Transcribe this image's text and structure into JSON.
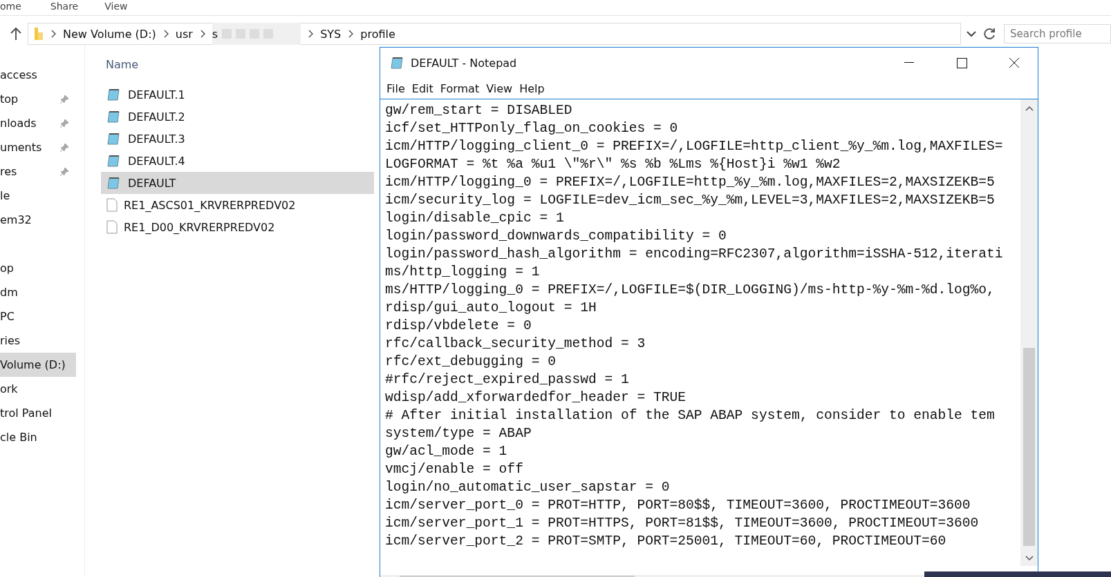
{
  "ribbon_tabs": [
    "ome",
    "Share",
    "View"
  ],
  "address_bar": {
    "crumbs": [
      {
        "kind": "text",
        "label": "New Volume (D:)"
      },
      {
        "kind": "text",
        "label": "usr"
      },
      {
        "kind": "redacted",
        "label": "s"
      },
      {
        "kind": "text",
        "label": "SYS"
      },
      {
        "kind": "text",
        "label": "profile"
      }
    ]
  },
  "search": {
    "placeholder": "Search profile"
  },
  "sidebar": {
    "sections": [
      {
        "items": [
          {
            "label": "access",
            "pinned": false,
            "selected": false
          },
          {
            "label": "top",
            "pinned": true,
            "selected": false
          },
          {
            "label": "nloads",
            "pinned": true,
            "selected": false
          },
          {
            "label": "uments",
            "pinned": true,
            "selected": false
          },
          {
            "label": "res",
            "pinned": true,
            "selected": false
          },
          {
            "label": "le",
            "pinned": false,
            "selected": false
          },
          {
            "label": "em32",
            "pinned": false,
            "selected": false
          }
        ]
      },
      {
        "items": [
          {
            "label": "op",
            "pinned": false,
            "selected": false
          },
          {
            "label": "dm",
            "pinned": false,
            "selected": false
          },
          {
            "label": "PC",
            "pinned": false,
            "selected": false
          },
          {
            "label": "ries",
            "pinned": false,
            "selected": false
          },
          {
            "label": "Volume (D:)",
            "pinned": false,
            "selected": true
          },
          {
            "label": "ork",
            "pinned": false,
            "selected": false
          },
          {
            "label": "trol Panel",
            "pinned": false,
            "selected": false
          },
          {
            "label": "cle Bin",
            "pinned": false,
            "selected": false
          }
        ]
      }
    ]
  },
  "file_list": {
    "column": "Name",
    "files": [
      {
        "name": "DEFAULT.1",
        "kind": "notepad",
        "selected": false
      },
      {
        "name": "DEFAULT.2",
        "kind": "notepad",
        "selected": false
      },
      {
        "name": "DEFAULT.3",
        "kind": "notepad",
        "selected": false
      },
      {
        "name": "DEFAULT.4",
        "kind": "notepad",
        "selected": false
      },
      {
        "name": "DEFAULT",
        "kind": "notepad",
        "selected": true
      },
      {
        "name": "RE1_ASCS01_KRVRERPREDV02",
        "kind": "blank",
        "selected": false
      },
      {
        "name": "RE1_D00_KRVRERPREDV02",
        "kind": "blank",
        "selected": false
      }
    ]
  },
  "notepad": {
    "title": "DEFAULT - Notepad",
    "menu": [
      "File",
      "Edit",
      "Format",
      "View",
      "Help"
    ],
    "lines": [
      "gw/rem_start = DISABLED",
      "icf/set_HTTPonly_flag_on_cookies = 0",
      "icm/HTTP/logging_client_0 = PREFIX=/,LOGFILE=http_client_%y_%m.log,MAXFILES=",
      "LOGFORMAT = %t %a %u1 \\\"%r\\\" %s %b %Lms %{Host}i %w1 %w2",
      "icm/HTTP/logging_0 = PREFIX=/,LOGFILE=http_%y_%m.log,MAXFILES=2,MAXSIZEKB=5",
      "icm/security_log = LOGFILE=dev_icm_sec_%y_%m,LEVEL=3,MAXFILES=2,MAXSIZEKB=5",
      "login/disable_cpic = 1",
      "login/password_downwards_compatibility = 0",
      "login/password_hash_algorithm = encoding=RFC2307,algorithm=iSSHA-512,iterati",
      "ms/http_logging = 1",
      "ms/HTTP/logging_0 = PREFIX=/,LOGFILE=$(DIR_LOGGING)/ms-http-%y-%m-%d.log%o,",
      "rdisp/gui_auto_logout = 1H",
      "rdisp/vbdelete = 0",
      "rfc/callback_security_method = 3",
      "rfc/ext_debugging = 0",
      "#rfc/reject_expired_passwd = 1",
      "wdisp/add_xforwardedfor_header = TRUE",
      "# After initial installation of the SAP ABAP system, consider to enable tem",
      "system/type = ABAP",
      "gw/acl_mode = 1",
      "vmcj/enable = off",
      "login/no_automatic_user_sapstar = 0",
      "icm/server_port_0 = PROT=HTTP, PORT=80$$, TIMEOUT=3600, PROCTIMEOUT=3600",
      "icm/server_port_1 = PROT=HTTPS, PORT=81$$, TIMEOUT=3600, PROCTIMEOUT=3600",
      "icm/server_port_2 = PROT=SMTP, PORT=25001, TIMEOUT=60, PROCTIMEOUT=60"
    ]
  }
}
